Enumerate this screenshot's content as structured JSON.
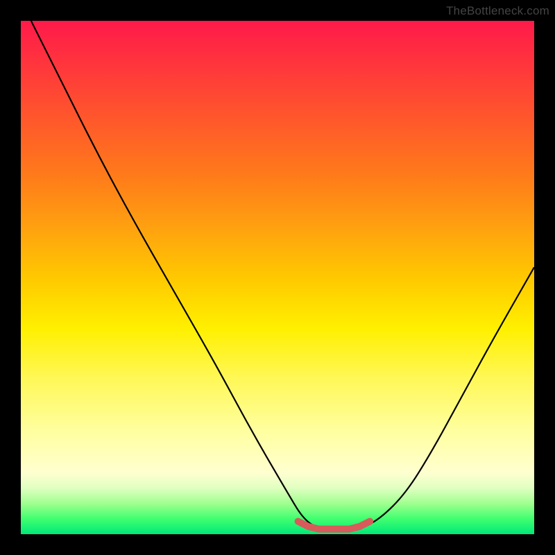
{
  "watermark": "TheBottleneck.com",
  "chart_data": {
    "type": "line",
    "title": "",
    "xlabel": "",
    "ylabel": "",
    "xlim": [
      0,
      100
    ],
    "ylim": [
      0,
      100
    ],
    "background_gradient": {
      "type": "vertical",
      "stops": [
        {
          "pos": 0,
          "color": "#ff1a4a"
        },
        {
          "pos": 0.5,
          "color": "#ffc800"
        },
        {
          "pos": 0.88,
          "color": "#ffffd0"
        },
        {
          "pos": 1.0,
          "color": "#00e878"
        }
      ]
    },
    "series": [
      {
        "name": "main-curve",
        "color": "#000000",
        "x": [
          2,
          8,
          15,
          22,
          30,
          38,
          45,
          52,
          55,
          58,
          62,
          66,
          70,
          75,
          80,
          86,
          92,
          100
        ],
        "y": [
          100,
          88,
          74,
          61,
          47,
          33,
          20,
          8,
          3,
          1,
          1,
          1,
          3,
          8,
          16,
          27,
          38,
          52
        ]
      },
      {
        "name": "highlight-band",
        "color": "#d95a5a",
        "thick": true,
        "x": [
          54,
          56,
          58,
          60,
          62,
          64,
          66,
          68
        ],
        "y": [
          2.5,
          1.5,
          1,
          1,
          1,
          1,
          1.5,
          2.5
        ]
      }
    ],
    "annotations": []
  }
}
